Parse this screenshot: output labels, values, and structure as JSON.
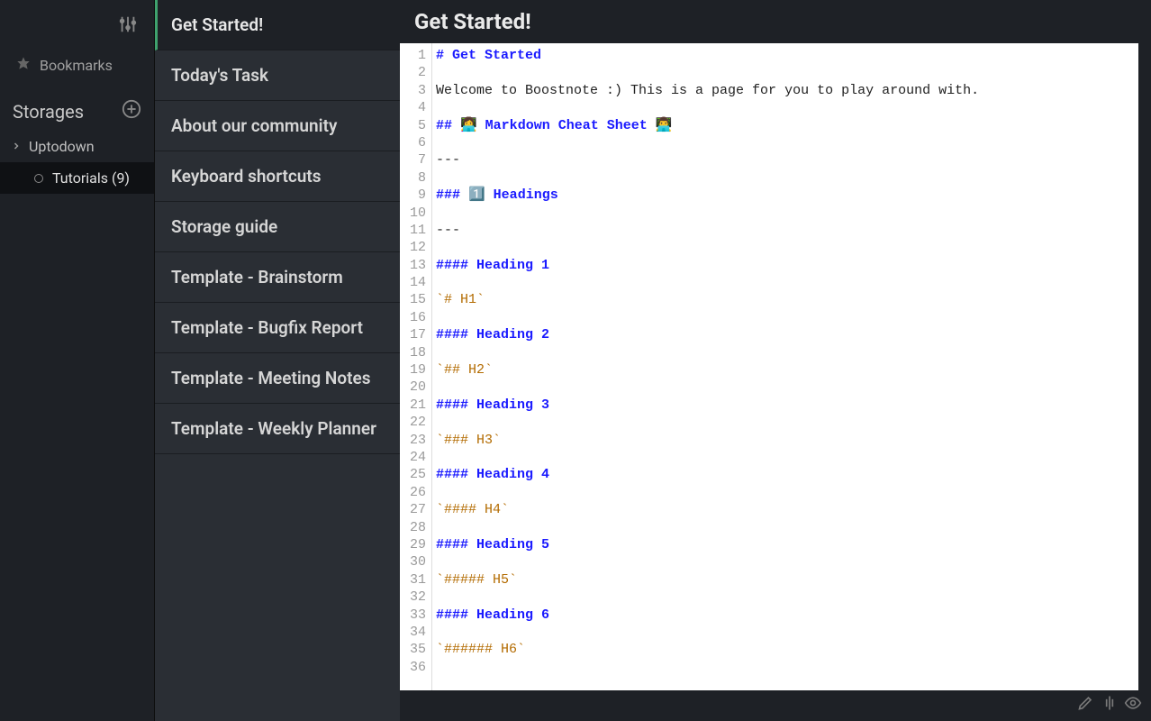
{
  "sidebar": {
    "bookmarks_label": "Bookmarks",
    "storages_label": "Storages",
    "storage_name": "Uptodown",
    "folder_label": "Tutorials (9)"
  },
  "notes": [
    {
      "label": "Get Started!"
    },
    {
      "label": "Today's Task"
    },
    {
      "label": "About our community"
    },
    {
      "label": "Keyboard shortcuts"
    },
    {
      "label": "Storage guide"
    },
    {
      "label": "Template - Brainstorm"
    },
    {
      "label": "Template - Bugfix Report"
    },
    {
      "label": "Template - Meeting Notes"
    },
    {
      "label": "Template - Weekly Planner"
    }
  ],
  "editor": {
    "title": "Get Started!",
    "lines": [
      {
        "t": "hdr",
        "text": "# Get Started"
      },
      {
        "t": "",
        "text": ""
      },
      {
        "t": "",
        "text": "Welcome to Boostnote :) This is a page for you to play around with."
      },
      {
        "t": "",
        "text": ""
      },
      {
        "t": "hdr",
        "text": "## 👩‍💻 Markdown Cheat Sheet 👨‍💻"
      },
      {
        "t": "",
        "text": ""
      },
      {
        "t": "",
        "text": "---"
      },
      {
        "t": "",
        "text": ""
      },
      {
        "t": "hdr",
        "text": "### 1️⃣ Headings"
      },
      {
        "t": "",
        "text": ""
      },
      {
        "t": "",
        "text": "---"
      },
      {
        "t": "",
        "text": ""
      },
      {
        "t": "hdr",
        "text": "#### Heading 1"
      },
      {
        "t": "",
        "text": ""
      },
      {
        "t": "codesp",
        "text": "`# H1`"
      },
      {
        "t": "",
        "text": ""
      },
      {
        "t": "hdr",
        "text": "#### Heading 2"
      },
      {
        "t": "",
        "text": ""
      },
      {
        "t": "codesp",
        "text": "`## H2`"
      },
      {
        "t": "",
        "text": ""
      },
      {
        "t": "hdr",
        "text": "#### Heading 3"
      },
      {
        "t": "",
        "text": ""
      },
      {
        "t": "codesp",
        "text": "`### H3`"
      },
      {
        "t": "",
        "text": ""
      },
      {
        "t": "hdr",
        "text": "#### Heading 4"
      },
      {
        "t": "",
        "text": ""
      },
      {
        "t": "codesp",
        "text": "`#### H4`"
      },
      {
        "t": "",
        "text": ""
      },
      {
        "t": "hdr",
        "text": "#### Heading 5"
      },
      {
        "t": "",
        "text": ""
      },
      {
        "t": "codesp",
        "text": "`##### H5`"
      },
      {
        "t": "",
        "text": ""
      },
      {
        "t": "hdr",
        "text": "#### Heading 6"
      },
      {
        "t": "",
        "text": ""
      },
      {
        "t": "codesp",
        "text": "`###### H6`"
      },
      {
        "t": "",
        "text": ""
      }
    ]
  }
}
